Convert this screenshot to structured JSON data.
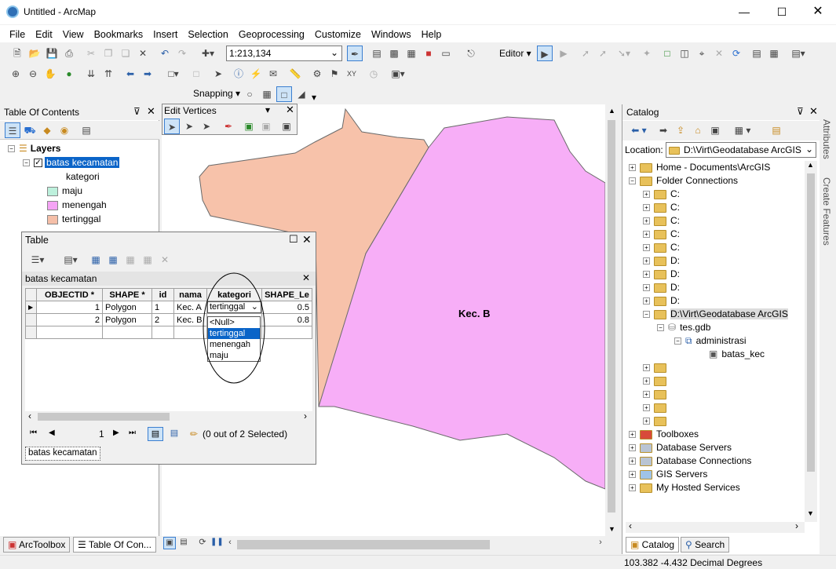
{
  "window": {
    "title": "Untitled - ArcMap",
    "min_icon": "minimize-icon",
    "max_icon": "maximize-icon",
    "close_icon": "close-icon"
  },
  "menu": [
    "File",
    "Edit",
    "View",
    "Bookmarks",
    "Insert",
    "Selection",
    "Geoprocessing",
    "Customize",
    "Windows",
    "Help"
  ],
  "toolbar": {
    "scale": "1:213,134",
    "editor_label": "Editor ▾",
    "snapping_label": "Snapping ▾"
  },
  "toc": {
    "title": "Table Of Contents",
    "root": "Layers",
    "layer": "batas kecamatan",
    "field": "kategori",
    "classes": [
      {
        "label": "maju",
        "color": "#bdf0dc"
      },
      {
        "label": "menengah",
        "color": "#f5a3f5"
      },
      {
        "label": "tertinggal",
        "color": "#f5bfa8"
      }
    ]
  },
  "edit_vertices": {
    "title": "Edit Vertices"
  },
  "map": {
    "label": "Kec. B",
    "colors": {
      "menengah": "#f7aef7",
      "tertinggal": "#f7c2aa"
    }
  },
  "table": {
    "title": "Table",
    "layer": "batas kecamatan",
    "columns": [
      "OBJECTID *",
      "SHAPE *",
      "id",
      "nama",
      "kategori",
      "SHAPE_Le"
    ],
    "rows": [
      {
        "oid": "1",
        "shape": "Polygon",
        "id": "1",
        "nama": "Kec. A",
        "kategori": "tertinggal",
        "len": "0.5"
      },
      {
        "oid": "2",
        "shape": "Polygon",
        "id": "2",
        "nama": "Kec. B",
        "kategori": "",
        "len": "0.8"
      }
    ],
    "dropdown": [
      "<Null>",
      "tertinggal",
      "menengah",
      "maju"
    ],
    "dropdown_selected": "tertinggal",
    "record": "1",
    "selected_status": "(0 out of 2 Selected)",
    "tab": "batas kecamatan"
  },
  "catalog": {
    "title": "Catalog",
    "location_label": "Location:",
    "location_value": "D:\\Virt\\Geodatabase ArcGIS",
    "items": [
      {
        "label": "Home - Documents\\ArcGIS",
        "indent": 0
      },
      {
        "label": "Folder Connections",
        "indent": 0
      },
      {
        "label": "C:",
        "indent": 1
      },
      {
        "label": "C:",
        "indent": 1
      },
      {
        "label": "C:",
        "indent": 1
      },
      {
        "label": "C:",
        "indent": 1
      },
      {
        "label": "C:",
        "indent": 1
      },
      {
        "label": "D:",
        "indent": 1
      },
      {
        "label": "D:",
        "indent": 1
      },
      {
        "label": "D:",
        "indent": 1
      },
      {
        "label": "D:",
        "indent": 1
      },
      {
        "label": "D:\\Virt\\Geodatabase ArcGIS",
        "indent": 1
      },
      {
        "label": "tes.gdb",
        "indent": 2
      },
      {
        "label": "administrasi",
        "indent": 3
      },
      {
        "label": "batas_kec",
        "indent": 4
      },
      {
        "label": "",
        "indent": 1
      },
      {
        "label": "",
        "indent": 1
      },
      {
        "label": "",
        "indent": 1
      },
      {
        "label": "",
        "indent": 1
      },
      {
        "label": "",
        "indent": 1
      },
      {
        "label": "Toolboxes",
        "indent": 0
      },
      {
        "label": "Database Servers",
        "indent": 0
      },
      {
        "label": "Database Connections",
        "indent": 0
      },
      {
        "label": "GIS Servers",
        "indent": 0
      },
      {
        "label": "My Hosted Services",
        "indent": 0
      }
    ],
    "tab_catalog": "Catalog",
    "tab_search": "Search",
    "side_tabs": [
      "Attributes",
      "Create Features"
    ]
  },
  "bottom_tabs": {
    "arctoolbox": "ArcToolbox",
    "toc": "Table Of Con..."
  },
  "status": {
    "coords": "103.382  -4.432 Decimal Degrees"
  }
}
